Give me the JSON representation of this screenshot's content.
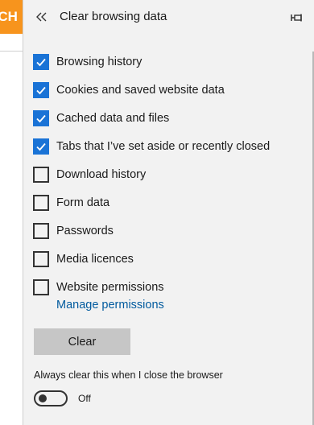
{
  "background": {
    "logo_fragment": "ECH",
    "logo_color": "#f7941d"
  },
  "header": {
    "back_icon": "double-chevron-left-icon",
    "title": "Clear browsing data",
    "pin_icon": "pin-icon"
  },
  "options": [
    {
      "label": "Browsing history",
      "checked": true
    },
    {
      "label": "Cookies and saved website data",
      "checked": true
    },
    {
      "label": "Cached data and files",
      "checked": true
    },
    {
      "label": "Tabs that I’ve set aside or recently closed",
      "checked": true
    },
    {
      "label": "Download history",
      "checked": false
    },
    {
      "label": "Form data",
      "checked": false
    },
    {
      "label": "Passwords",
      "checked": false
    },
    {
      "label": "Media licences",
      "checked": false
    },
    {
      "label": "Website permissions",
      "checked": false
    }
  ],
  "manage_link": "Manage permissions",
  "clear_button": "Clear",
  "always_clear": {
    "label": "Always clear this when I close the browser",
    "state": "Off",
    "on": false
  },
  "colors": {
    "accent": "#1a73d6",
    "link": "#005a9e",
    "panel_bg": "#f2f2f2",
    "button_bg": "#c6c6c6"
  }
}
